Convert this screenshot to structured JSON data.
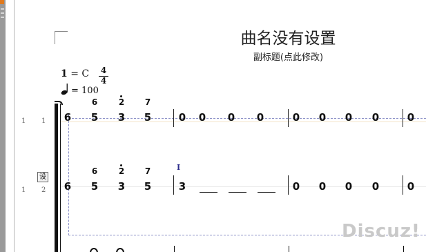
{
  "score": {
    "title": "曲名没有设置",
    "subtitle": "副标题(点此修改)",
    "key_num": "1",
    "key_rest": " = C",
    "time_top": "4",
    "time_bottom": "4",
    "tempo": "= 100"
  },
  "rows": [
    {
      "a": "1",
      "b": "1"
    },
    {
      "a": "1",
      "b": "2"
    }
  ],
  "lyric_button_label": "设",
  "cursor_glyph": "I",
  "row1": {
    "m1": [
      "6",
      "5",
      "3",
      "5"
    ],
    "m1_high": [
      "6",
      "2",
      "7"
    ],
    "m2": [
      "0",
      "0",
      "0",
      "0"
    ],
    "m3": [
      "0",
      "0",
      "0",
      "0"
    ],
    "m4": [
      "0"
    ]
  },
  "row2": {
    "m1": [
      "6",
      "5",
      "3",
      "5"
    ],
    "m1_high": [
      "6",
      "2",
      "7"
    ],
    "m2": [
      "3"
    ],
    "m3": [
      "0",
      "0",
      "0",
      "0"
    ],
    "m4": [
      "0"
    ]
  },
  "watermark": "Discuz!",
  "colors": {
    "guide_dash": "#8a8fc7",
    "ruler_accent": "#e07a1f"
  }
}
